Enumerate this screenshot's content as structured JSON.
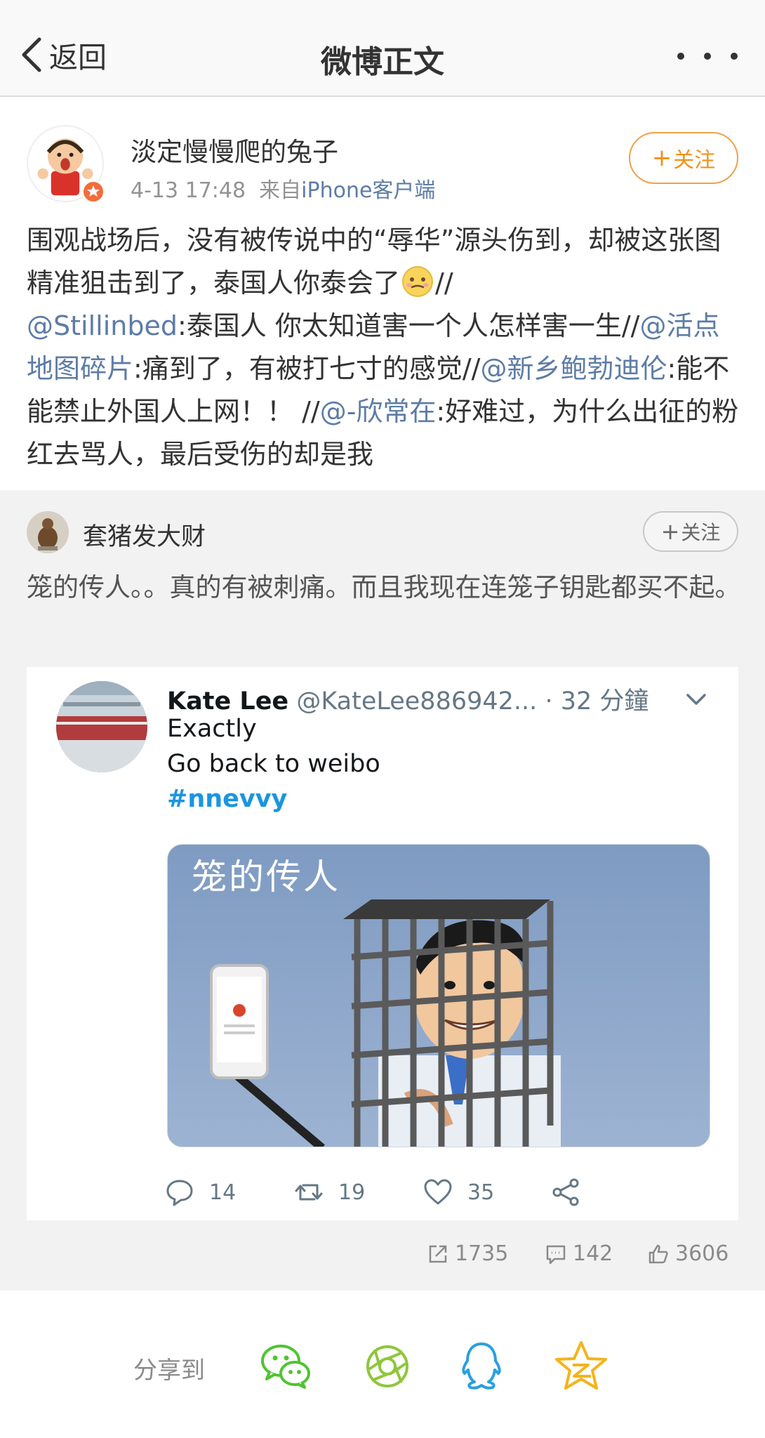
{
  "nav": {
    "back_label": "返回",
    "title": "微博正文"
  },
  "post": {
    "author": "淡定慢慢爬的兔子",
    "time": "4-13 17:48",
    "source_prefix": "来自",
    "source": "iPhone客户端",
    "follow_label": "关注",
    "text": {
      "t1": "围观战场后，没有被传说中的“辱华”源头伤到，却被这张图精准狙击到了，泰国人你泰会了",
      "t2": "//",
      "m1": "@Stillinbed",
      "t3": ":泰国人 你太知道害一个人怎样害一生//",
      "m2": "@活点地图碎片",
      "t4": ":痛到了，有被打七寸的感觉//",
      "m3": "@新乡鲍勃迪伦",
      "t5": ":能不能禁止外国人上网！！ //",
      "m4": "@-欣常在",
      "t6": ":好难过，为什么出征的粉红去骂人，最后受伤的却是我"
    }
  },
  "repost": {
    "author": "套猪发大财",
    "follow_label": "关注",
    "text": "笼的传人。。真的有被刺痛。而且我现在连笼子钥匙都买不起。",
    "tweet": {
      "name": "Kate Lee",
      "handle": "@KateLee886942...",
      "time": "· 32 分鐘",
      "line1": "Exactly",
      "line2": "Go back to weibo",
      "hashtag": "#nnevvy",
      "image_caption": "笼的传人",
      "replies": "14",
      "retweets": "19",
      "likes": "35"
    },
    "stats": {
      "reposts": "1735",
      "comments": "142",
      "likes": "3606"
    }
  },
  "share": {
    "label": "分享到"
  },
  "colors": {
    "link": "#5d7ca6",
    "follow_orange": "#f0921a",
    "twitter_blue": "#1b95e0"
  },
  "icons": [
    "back-chevron-icon",
    "more-dots-icon",
    "verified-badge-icon",
    "smile-emoji-icon",
    "reply-icon",
    "retweet-icon",
    "heart-icon",
    "share-icon",
    "repost-icon",
    "comment-icon",
    "thumb-up-icon",
    "wechat-icon",
    "moments-icon",
    "qq-icon",
    "qzone-icon"
  ]
}
